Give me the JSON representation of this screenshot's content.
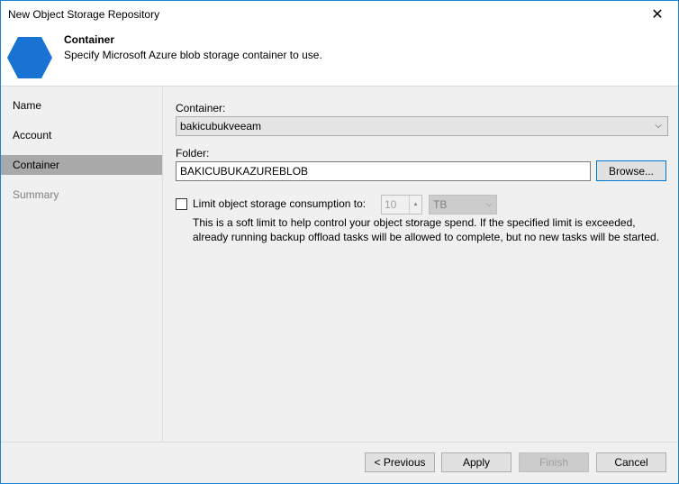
{
  "window": {
    "title": "New Object Storage Repository",
    "close_glyph": "✕"
  },
  "header": {
    "title": "Container",
    "subtitle": "Specify Microsoft Azure blob storage container to use.",
    "icon": "hexagon-icon",
    "icon_color": "#1873d3"
  },
  "sidebar": {
    "items": [
      {
        "label": "Name",
        "state": "normal"
      },
      {
        "label": "Account",
        "state": "normal"
      },
      {
        "label": "Container",
        "state": "active"
      },
      {
        "label": "Summary",
        "state": "disabled"
      }
    ]
  },
  "form": {
    "container_label": "Container:",
    "container_value": "bakicubukveeam",
    "folder_label": "Folder:",
    "folder_value": "BAKICUBUKAZUREBLOB",
    "browse_label": "Browse...",
    "limit_label": "Limit object storage consumption to:",
    "limit_checked": false,
    "limit_value": "10",
    "limit_unit": "TB",
    "description": "This is a soft limit to help control your object storage spend. If the specified limit is exceeded, already running backup offload tasks will be allowed to complete, but no new tasks will be started."
  },
  "footer": {
    "previous_label": "< Previous",
    "apply_label": "Apply",
    "finish_label": "Finish",
    "cancel_label": "Cancel"
  }
}
